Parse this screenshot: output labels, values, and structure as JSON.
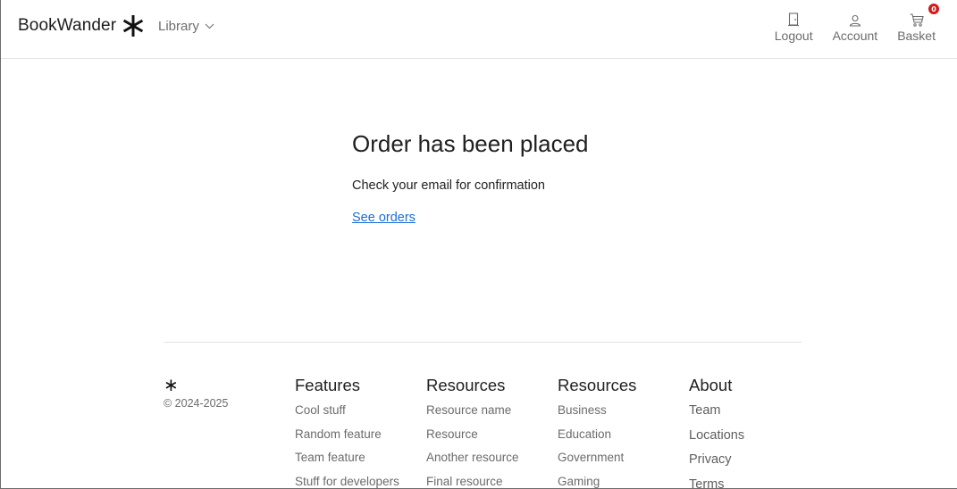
{
  "header": {
    "brand": "BookWander",
    "library_menu": "Library",
    "nav": {
      "logout": "Logout",
      "account": "Account",
      "basket": "Basket",
      "basket_count": "0"
    }
  },
  "main": {
    "title": "Order has been placed",
    "subtitle": "Check your email for confirmation",
    "link": "See orders"
  },
  "footer": {
    "mark": "∗",
    "copyright": "© 2024-2025",
    "columns": [
      {
        "title": "Features",
        "links": [
          "Cool stuff",
          "Random feature",
          "Team feature",
          "Stuff for developers"
        ]
      },
      {
        "title": "Resources",
        "links": [
          "Resource name",
          "Resource",
          "Another resource",
          "Final resource"
        ]
      },
      {
        "title": "Resources",
        "links": [
          "Business",
          "Education",
          "Government",
          "Gaming"
        ]
      },
      {
        "title": "About",
        "links": [
          "Team",
          "Locations",
          "Privacy",
          "Terms"
        ]
      }
    ]
  },
  "colors": {
    "link": "#1a6fd8",
    "badge": "#d11a1a",
    "text": "#212529",
    "muted": "#6b6b6b"
  },
  "icons": {
    "brand": "asterisk-icon",
    "library": "chevron-down-icon",
    "logout": "door-icon",
    "account": "user-icon",
    "basket": "cart-icon"
  }
}
